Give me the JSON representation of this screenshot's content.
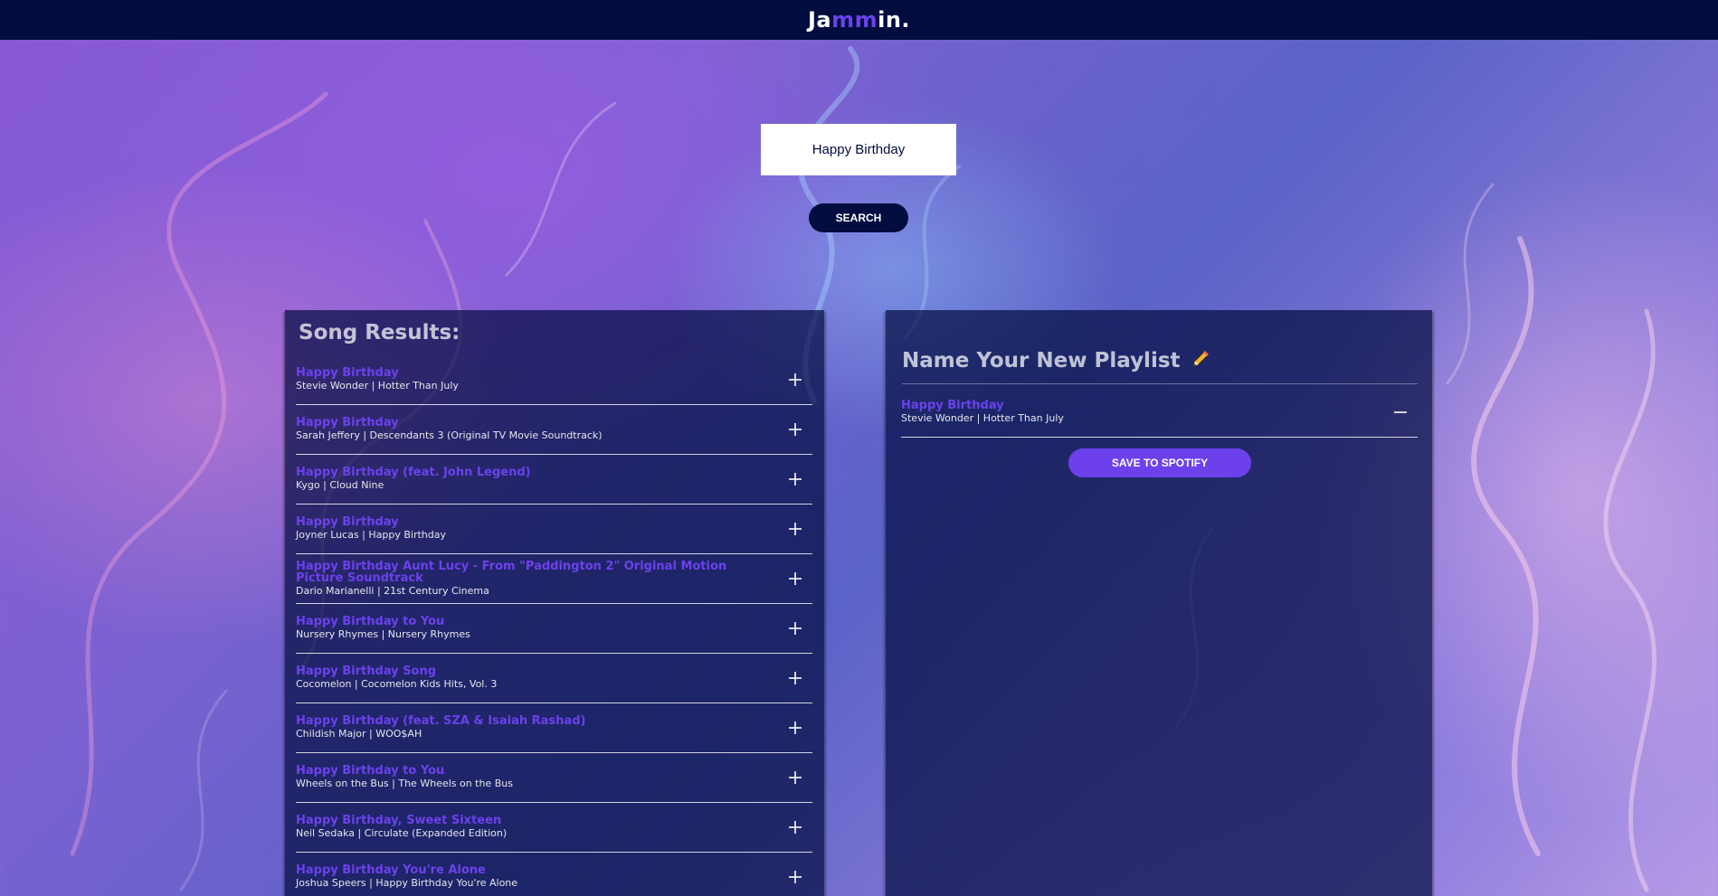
{
  "app": {
    "logo_prefix": "Ja",
    "logo_accent": "mm",
    "logo_suffix": "in.",
    "accent_color": "#6c41ec",
    "header_color": "#010c3f"
  },
  "search": {
    "value": "Happy Birthday",
    "button_label": "SEARCH"
  },
  "results": {
    "title": "Song Results:",
    "add_icon": "plus-icon",
    "tracks": [
      {
        "name": "Happy Birthday",
        "meta": "Stevie Wonder | Hotter Than July"
      },
      {
        "name": "Happy Birthday",
        "meta": "Sarah Jeffery | Descendants 3 (Original TV Movie Soundtrack)"
      },
      {
        "name": "Happy Birthday (feat. John Legend)",
        "meta": "Kygo | Cloud Nine"
      },
      {
        "name": "Happy Birthday",
        "meta": "Joyner Lucas | Happy Birthday"
      },
      {
        "name": "Happy Birthday Aunt Lucy - From \"Paddington 2\" Original Motion Picture Soundtrack",
        "meta": "Dario Marianelli | 21st Century Cinema"
      },
      {
        "name": "Happy Birthday to You",
        "meta": "Nursery Rhymes | Nursery Rhymes"
      },
      {
        "name": "Happy Birthday Song",
        "meta": "Cocomelon | Cocomelon Kids Hits, Vol. 3"
      },
      {
        "name": "Happy Birthday (feat. SZA & Isaiah Rashad)",
        "meta": "Childish Major | WOO$AH"
      },
      {
        "name": "Happy Birthday to You",
        "meta": "Wheels on the Bus | The Wheels on the Bus"
      },
      {
        "name": "Happy Birthday, Sweet Sixteen",
        "meta": "Neil Sedaka | Circulate (Expanded Edition)"
      },
      {
        "name": "Happy Birthday You're Alone",
        "meta": "Joshua Speers | Happy Birthday You're Alone"
      }
    ]
  },
  "playlist": {
    "name": "Name Your New Playlist",
    "edit_icon": "pencil-icon",
    "remove_icon": "minus-icon",
    "tracks": [
      {
        "name": "Happy Birthday",
        "meta": "Stevie Wonder | Hotter Than July"
      }
    ],
    "save_label": "SAVE TO SPOTIFY"
  }
}
